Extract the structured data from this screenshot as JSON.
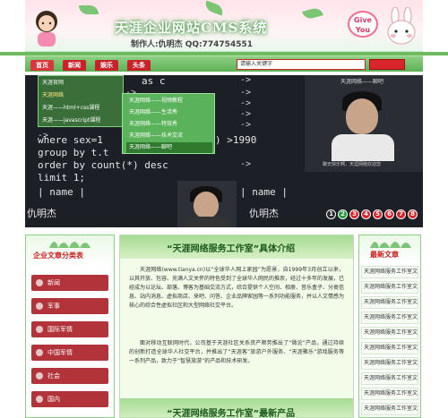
{
  "header": {
    "title": "天涯企业网站CMS系统",
    "author": "制作人:仇明杰  QQ:774754551",
    "badge_line1": "Give",
    "badge_line2": "You"
  },
  "nav": {
    "items": [
      {
        "label": "首页"
      },
      {
        "label": "新闻"
      },
      {
        "label": "娱乐"
      },
      {
        "label": "头条"
      }
    ],
    "search_placeholder": "请输入关键字",
    "search_button_label": ""
  },
  "banner": {
    "code_lines": [
      "as c",
      "->",
      "->",
      "->",
      "->",
      "->",
      "where sex=1",
      "group by t.t",
      "order by count(*) desc",
      "limit 1;",
      "| name |",
      "仇明杰"
    ],
    "right_code_lines": [
      "->",
      "->",
      "->",
      "->",
      "->",
      ") >1990",
      "->",
      "| name |",
      "仇明杰"
    ],
    "dropdown": {
      "items": [
        {
          "label": "天涯官网"
        },
        {
          "label": "天涯网络"
        },
        {
          "label": "天涯——html+css课程"
        },
        {
          "label": "天涯——javascript课程"
        }
      ]
    },
    "submenu": {
      "items": [
        {
          "label": "天涯网络——视频教程"
        },
        {
          "label": "天涯网络——生活秀"
        },
        {
          "label": "天涯网络——特效秀"
        },
        {
          "label": "天涯网络——技术交流"
        },
        {
          "label": "天涯网络——聊吧"
        }
      ]
    },
    "right_video_caption": "天涯网络——聊吧",
    "right_video_subcaption": "聊天快乐啊，天涯网络欢迎您",
    "slide_numbers": [
      "1",
      "2",
      "3",
      "4",
      "5",
      "6",
      "7",
      "8"
    ]
  },
  "left_column": {
    "title": "企业文章分类表",
    "categories": [
      {
        "label": "新闻"
      },
      {
        "label": "军事"
      },
      {
        "label": "国际军情"
      },
      {
        "label": "中国军情"
      },
      {
        "label": "社会"
      },
      {
        "label": "国内"
      }
    ]
  },
  "middle_column": {
    "title": "“天涯网络服务工作室”具体介绍",
    "paragraph1": "天涯网络(www.tianya.cn)以“全球华人网上家园”为愿景，自1999年3月创立以来，以其开放、包容、充满人文关怀的特色受到了全球华人网民的推崇，经过十多年的发展，已经成为以论坛、部落、博客为基础交流方式，综合提供个人空间、相册、音乐盒子、分类信息、站内消息、虚拟商店、来吧、问答、企业品牌家园等一系列功能服务，并以人文情感为核心的综合性虚拟社区和大型网络社交平台。",
    "paragraph2": "面对移动互联网时代，公司基于天涯社区关系资产顺势推出了“微论”产品，通过持续的创新打造全球华人社交平台，并推出了“天涯客”旅游户外服务、“天涯聚乐”游戏服务等一系列产品，致力于“智慧旅游”的产品和技术研发。",
    "title2": "“天涯网络服务工作室”最新产品"
  },
  "right_column": {
    "title": "最新文章",
    "news": [
      {
        "label": "天涯网络服务工作室文章1"
      },
      {
        "label": "天涯网络服务工作室文章2"
      },
      {
        "label": "天涯网络服务工作室文章3"
      },
      {
        "label": "天涯网络服务工作室文章4"
      },
      {
        "label": "天涯网络服务工作室文章5"
      },
      {
        "label": "天涯网络服务工作室文章6"
      },
      {
        "label": "天涯网络服务工作室文章7"
      },
      {
        "label": "天涯网络服务工作室文章8"
      },
      {
        "label": "天涯网络服务工作室文章9"
      },
      {
        "label": "天涯网络服务工作室文章10"
      }
    ]
  },
  "colors": {
    "accent_green": "#6dbb5e",
    "accent_red": "#c8232a",
    "banner_bg": "#1d1f26"
  }
}
